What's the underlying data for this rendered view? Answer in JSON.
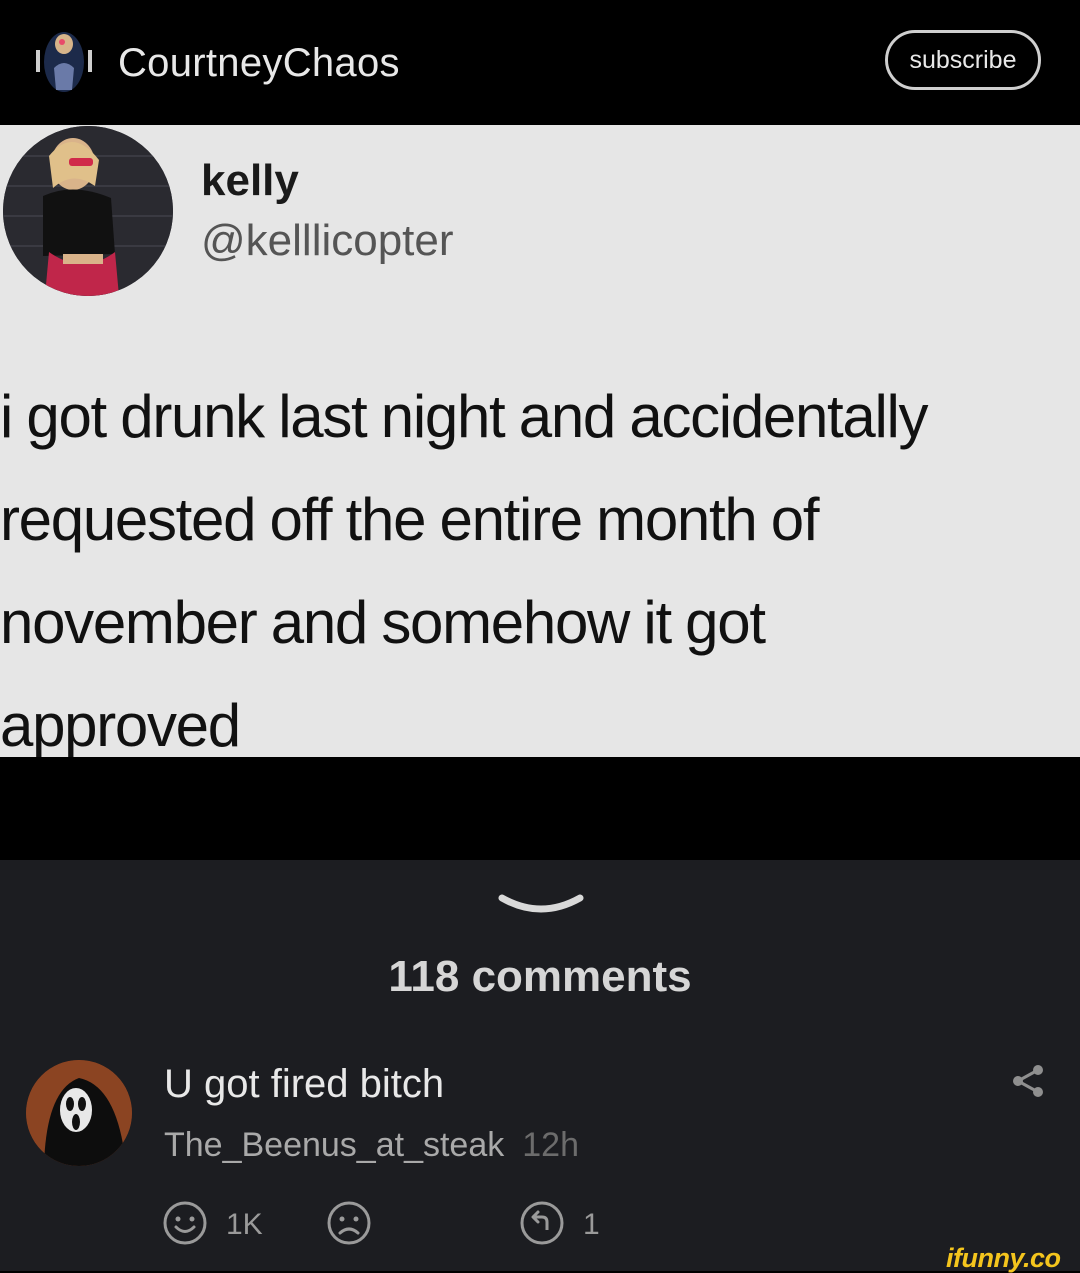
{
  "header": {
    "username": "CourtneyChaos",
    "subscribe_label": "subscribe"
  },
  "tweet": {
    "name": "kelly",
    "handle": "@kelllicopter",
    "text_lines": [
      "i got drunk last night and accidentally",
      "requested off the entire month of",
      "november and somehow it got",
      "approved"
    ]
  },
  "comments": {
    "count_label": "118 comments",
    "items": [
      {
        "text": "U got fired bitch",
        "author": "The_Beenus_at_steak",
        "time": "12h",
        "smile_count": "1K",
        "reply_count": "1"
      }
    ]
  },
  "watermark": "ifunny.co",
  "colors": {
    "header_bg": "#000000",
    "tweet_bg": "#e6e6e6",
    "panel_bg": "#1c1d21",
    "watermark": "#f4c51d"
  }
}
